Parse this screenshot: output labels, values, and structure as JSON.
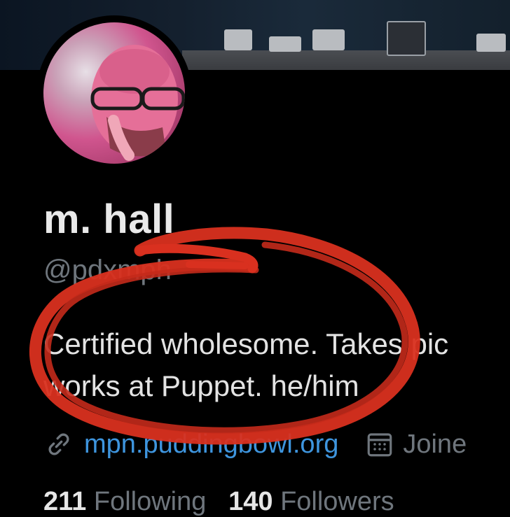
{
  "profile": {
    "display_name": "m. hall",
    "handle": "@pdxmph",
    "bio_line1": "Certified wholesome. Takes pic",
    "bio_line2": "works at Puppet. he/him",
    "website": "mpn.puddingbowl.org",
    "joined_label": "Joine",
    "following_count": "211",
    "following_label": "Following",
    "followers_count": "140",
    "followers_label": "Followers"
  },
  "icons": {
    "link": "link-icon",
    "calendar": "calendar-icon"
  },
  "colors": {
    "background": "#000000",
    "link": "#3e95de",
    "muted": "#6f767d",
    "annotation": "#d9301f"
  }
}
